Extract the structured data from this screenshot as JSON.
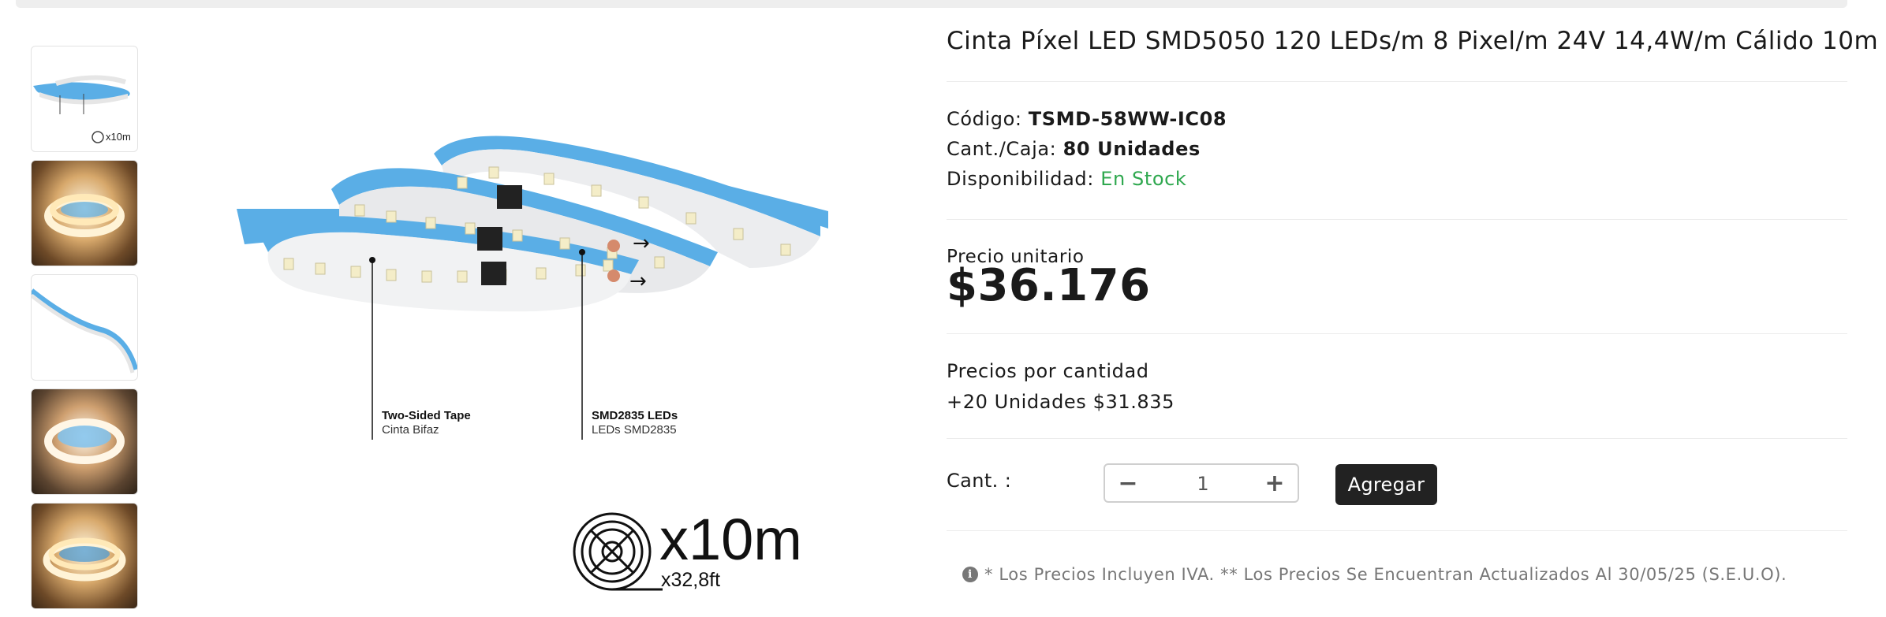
{
  "product": {
    "title": "Cinta Píxel LED SMD5050 120 LEDs/m 8 Pixel/m 24V 14,4W/m Cálido 10m",
    "code_label": "Código:",
    "code_value": "TSMD-58WW-IC08",
    "box_label": "Cant./Caja:",
    "box_value": "80 Unidades",
    "availability_label": "Disponibilidad:",
    "availability_value": "En Stock"
  },
  "pricing": {
    "unit_label": "Precio unitario",
    "unit_price": "$36.176",
    "quantity_title": "Precios por cantidad",
    "quantity_tier": "+20 Unidades $31.835"
  },
  "cart": {
    "qty_label": "Cant. :",
    "qty_value": "1",
    "minus_symbol": "−",
    "plus_symbol": "+",
    "add_label": "Agregar"
  },
  "note": {
    "icon": "info-icon",
    "icon_glyph": "i",
    "text": "* Los Precios Incluyen IVA. ** Los Precios Se Encuentran Actualizados Al 30/05/25 (S.E.U.O)."
  },
  "image": {
    "callout_1_title": "Two-Sided Tape",
    "callout_1_sub": "Cinta Bifaz",
    "callout_2_title": "SMD2835 LEDs",
    "callout_2_sub": "LEDs SMD2835",
    "length_main": "x10m",
    "length_sub": "x32,8ft",
    "thumb_length": "x10m"
  },
  "colors": {
    "tape_blue": "#5aaee6",
    "stock_green": "#2fa84f",
    "button_dark": "#222222"
  }
}
